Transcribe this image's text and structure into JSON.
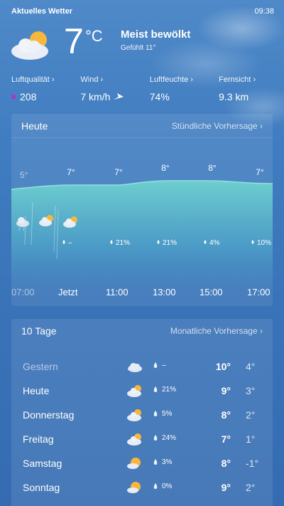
{
  "app": {
    "title": "Aktuelles Wetter",
    "time": "09:38"
  },
  "current": {
    "temp": "7",
    "unit": "°C",
    "condition": "Meist bewölkt",
    "feels_like": "Gefühlt 11°",
    "icon": "partly-cloudy-icon"
  },
  "metrics": [
    {
      "label": "Luftqualität",
      "value": "208",
      "color": "#a43ac3"
    },
    {
      "label": "Wind",
      "value": "7 km/h",
      "icon": "wind-direction-icon"
    },
    {
      "label": "Luftfeuchte",
      "value": "74%"
    },
    {
      "label": "Fernsicht",
      "value": "9.3 km"
    }
  ],
  "hourly": {
    "title": "Heute",
    "link": "Stündliche Vorhersage",
    "temps": [
      "5°",
      "7°",
      "7°",
      "8°",
      "8°",
      "7°"
    ],
    "times": [
      "07:00",
      "Jetzt",
      "11:00",
      "13:00",
      "15:00",
      "17:00"
    ],
    "precip": [
      "",
      "–",
      "21%",
      "21%",
      "4%",
      "10%"
    ]
  },
  "daily": {
    "title": "10 Tage",
    "link": "Monatliche Vorhersage",
    "days": [
      {
        "name": "Gestern",
        "precip": "–",
        "high": "10°",
        "low": "4°",
        "icon": "cloud-icon"
      },
      {
        "name": "Heute",
        "precip": "21%",
        "high": "9°",
        "low": "3°",
        "icon": "partly-cloudy-icon"
      },
      {
        "name": "Donnerstag",
        "precip": "5%",
        "high": "8°",
        "low": "2°",
        "icon": "partly-cloudy-icon"
      },
      {
        "name": "Freitag",
        "precip": "24%",
        "high": "7°",
        "low": "1°",
        "icon": "partly-cloudy-icon"
      },
      {
        "name": "Samstag",
        "precip": "3%",
        "high": "8°",
        "low": "-1°",
        "icon": "sun-behind-cloud-icon"
      },
      {
        "name": "Sonntag",
        "precip": "0%",
        "high": "9°",
        "low": "2°",
        "icon": "sun-behind-cloud-icon"
      }
    ]
  },
  "colors": {
    "sky_top": "#4f89c8",
    "sky_bottom": "#356cb1",
    "chart_fill_top": "#6fd2cf",
    "chart_fill_bottom": "#3a73b8",
    "aq_color": "#a43ac3",
    "sun": "#f6b73c"
  }
}
